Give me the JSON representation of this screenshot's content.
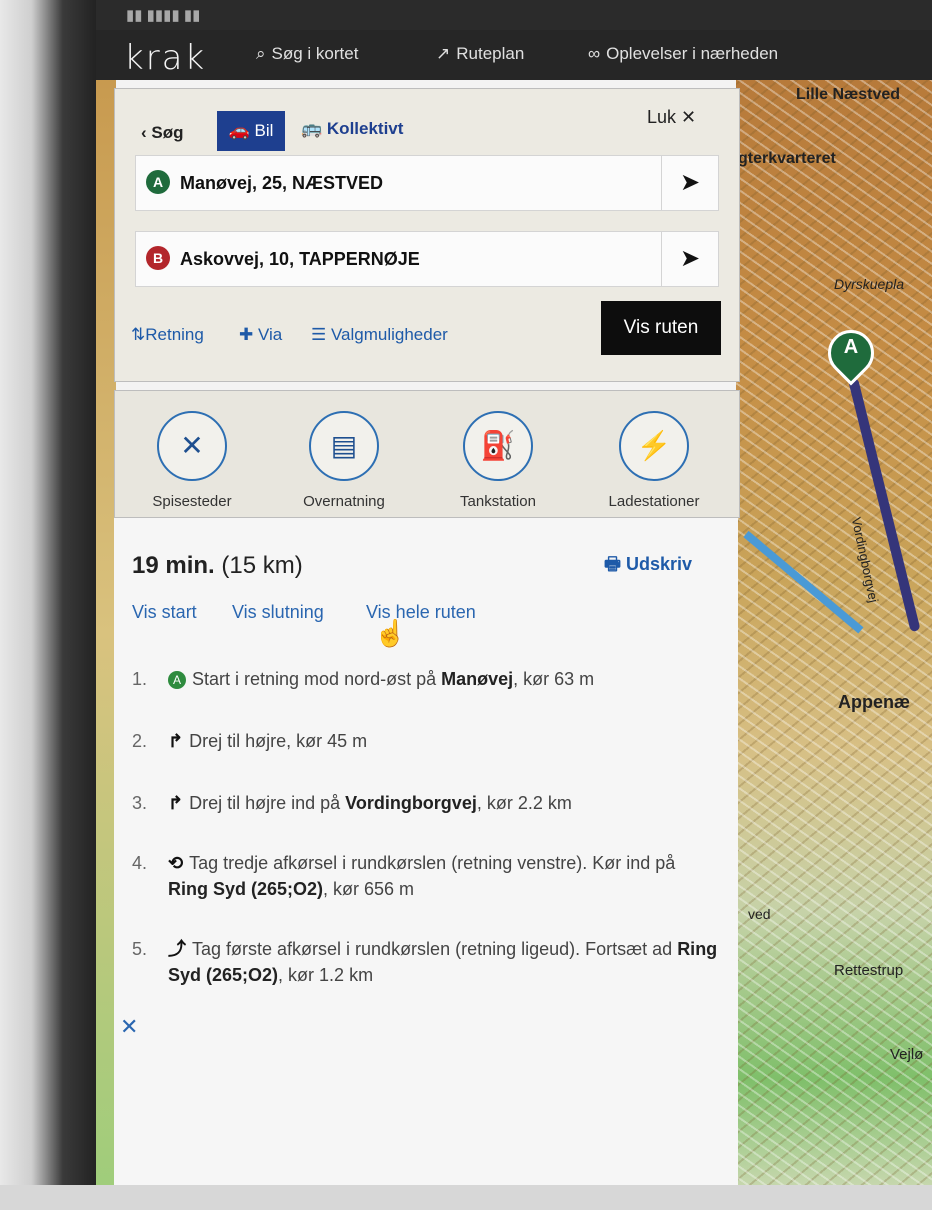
{
  "app": {
    "logo": "krak",
    "nav": [
      {
        "icon": "search-icon",
        "label": "Søg i kortet"
      },
      {
        "icon": "route-icon",
        "label": "Ruteplan"
      },
      {
        "icon": "binoculars-icon",
        "label": "Oplevelser i nærheden"
      }
    ]
  },
  "route": {
    "back_label": "Søg",
    "modes": {
      "car": "Bil",
      "transit": "Kollektivt"
    },
    "close_label": "Luk",
    "from": {
      "badge": "A",
      "value": "Manøvej, 25, NÆSTVED"
    },
    "to": {
      "badge": "B",
      "value": "Askovvej, 10, TAPPERNØJE"
    },
    "options": {
      "direction": "Retning",
      "via": "Via",
      "settings": "Valgmuligheder"
    },
    "show_route": "Vis ruten"
  },
  "poi": [
    {
      "icon": "restaurant-icon",
      "glyph": "✕",
      "label": "Spisesteder"
    },
    {
      "icon": "bed-icon",
      "glyph": "▤",
      "label": "Overnatning"
    },
    {
      "icon": "fuel-icon",
      "glyph": "⛽",
      "label": "Tankstation"
    },
    {
      "icon": "charging-icon",
      "glyph": "⚡",
      "label": "Ladestationer"
    }
  ],
  "directions": {
    "duration": "19 min.",
    "distance": "(15 km)",
    "print_label": "Udskriv",
    "views": [
      "Vis start",
      "Vis slutning",
      "Vis hele ruten"
    ],
    "steps": [
      {
        "num": "1.",
        "pre": "Start i retning mod nord-øst på ",
        "road": "Manøvej",
        "post": ", kør 63 m"
      },
      {
        "num": "2.",
        "pre": "Drej til højre, kør 45 m",
        "road": "",
        "post": ""
      },
      {
        "num": "3.",
        "pre": "Drej til højre ind på ",
        "road": "Vordingborgvej",
        "post": ", kør 2.2 km"
      },
      {
        "num": "4.",
        "pre": "Tag tredje afkørsel i rundkørslen (retning venstre). Kør ind på ",
        "road": "Ring Syd (265;O2)",
        "post": ", kør 656 m"
      },
      {
        "num": "5.",
        "pre": "Tag første afkørsel i rundkørslen (retning ligeud). Fortsæt ad ",
        "road": "Ring Syd (265;O2)",
        "post": ", kør 1.2 km"
      }
    ]
  },
  "map": {
    "labels": [
      "Lille Næstved",
      "gterkvarteret",
      "Dyrskuepla",
      "Vordingborgvej",
      "Appenæ",
      "ved",
      "Rettestrup",
      "Vejlø"
    ],
    "pin": "A"
  },
  "colors": {
    "accent": "#1e3f8f",
    "link": "#2a66b0",
    "pin_start": "#2e8b3e",
    "pin_end": "#b3262b"
  }
}
